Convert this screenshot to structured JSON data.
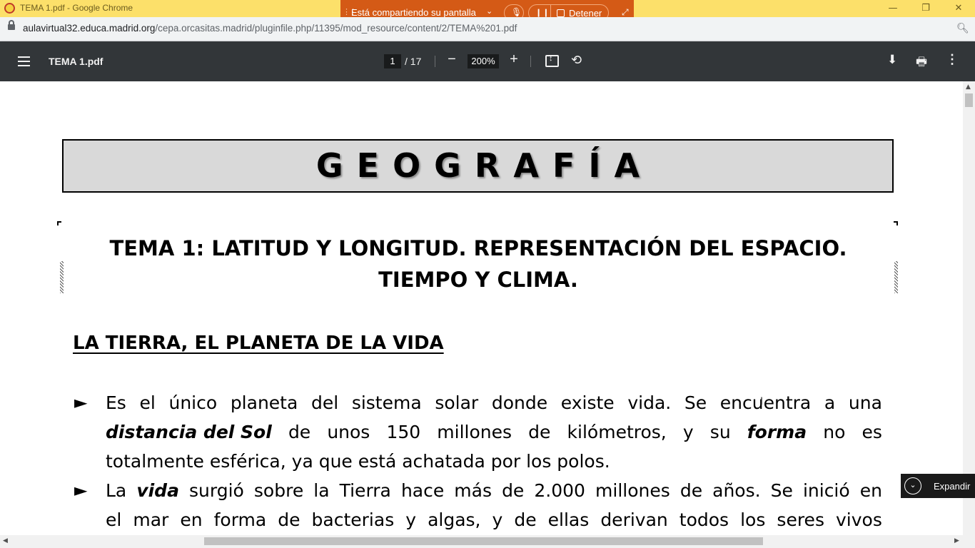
{
  "window": {
    "title": "TEMA 1.pdf - Google Chrome",
    "minimize": "—",
    "restore": "❐",
    "close": "✕"
  },
  "share_bar": {
    "text": "Está compartiendo su pantalla",
    "stop_label": "Detener",
    "background": "#d45a16"
  },
  "address_bar": {
    "host": "aulavirtual32.educa.madrid.org",
    "path": "/cepa.orcasitas.madrid/pluginfile.php/11395/mod_resource/content/2/TEMA%201.pdf"
  },
  "pdf_toolbar": {
    "doc_title": "TEMA 1.pdf",
    "current_page": "1",
    "total_pages": "/ 17",
    "zoom": "200%",
    "background": "#323639"
  },
  "document": {
    "banner": "GEOGRAFÍA",
    "tema_line1": "TEMA 1: LATITUD Y LONGITUD. REPRESENTACIÓN DEL ESPACIO.",
    "tema_line2": "TIEMPO Y CLIMA.",
    "section_heading": "LA TIERRA, EL PLANETA DE LA VIDA",
    "bullet_symbol": "►",
    "p1_line1": [
      "Es",
      "el",
      "único",
      "planeta",
      "del",
      "sistema",
      "solar",
      "donde",
      "existe",
      "vida.",
      "Se",
      "encuentra",
      "a",
      "una"
    ],
    "p1_line2_em1": "distancia del Sol",
    "p1_line2_mid": [
      "de",
      "unos",
      "150",
      "millones",
      "de",
      "kilómetros,",
      "y",
      "su"
    ],
    "p1_line2_em2": "forma",
    "p1_line2_end": [
      "no",
      "es"
    ],
    "p1_line3": "totalmente esférica, ya que está achatada por los polos.",
    "p2_line1_start": "La",
    "p2_line1_em": "vida",
    "p2_line1_rest": [
      "surgió",
      "sobre",
      "la",
      "Tierra",
      "hace",
      "más",
      "de",
      "2.000",
      "millones",
      "de",
      "años.",
      "Se",
      "inició",
      "en"
    ],
    "p2_line2": [
      "el",
      "mar",
      "en",
      "forma",
      "de",
      "bacterias",
      "y",
      "algas,",
      "y",
      "de",
      "ellas",
      "derivan",
      "todos",
      "los",
      "seres",
      "vivos"
    ]
  },
  "expand_popup": {
    "label": "Expandir"
  }
}
